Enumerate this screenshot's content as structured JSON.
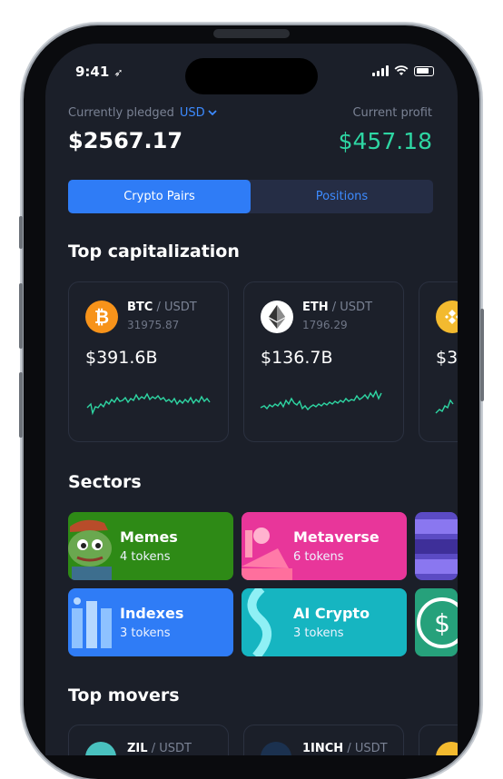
{
  "status": {
    "time": "9:41"
  },
  "header": {
    "pledged_label": "Currently pledged",
    "currency": "USD",
    "pledged_value": "$2567.17",
    "profit_label": "Current profit",
    "profit_value": "$457.18"
  },
  "tabs": [
    {
      "label": "Crypto Pairs",
      "active": true
    },
    {
      "label": "Positions",
      "active": false
    }
  ],
  "top_cap": {
    "title": "Top capitalization",
    "cards": [
      {
        "base": "BTC",
        "quote": "/ USDT",
        "price": "31975.87",
        "cap": "$391.6B",
        "icon": "bitcoin-icon",
        "color": "#f7931a"
      },
      {
        "base": "ETH",
        "quote": "/ USDT",
        "price": "1796.29",
        "cap": "$136.7B",
        "icon": "ethereum-icon",
        "color": "#ffffff"
      },
      {
        "cap": "$3",
        "icon": "binance-icon",
        "color": "#f3ba2f"
      }
    ]
  },
  "sectors": {
    "title": "Sectors",
    "items": [
      {
        "name": "Memes",
        "count": "4 tokens",
        "color": "#2e8a16"
      },
      {
        "name": "Metaverse",
        "count": "6 tokens",
        "color": "#e8369a"
      },
      {
        "name": "Indexes",
        "count": "3 tokens",
        "color": "#2f7cf6"
      },
      {
        "name": "AI Crypto",
        "count": "3 tokens",
        "color": "#16b5c1"
      }
    ]
  },
  "top_movers": {
    "title": "Top movers",
    "cards": [
      {
        "base": "ZIL",
        "quote": "/ USDT"
      },
      {
        "base": "1INCH",
        "quote": "/ USDT"
      }
    ]
  },
  "accent": "#2f7cf6",
  "positive": "#2ed6a3"
}
